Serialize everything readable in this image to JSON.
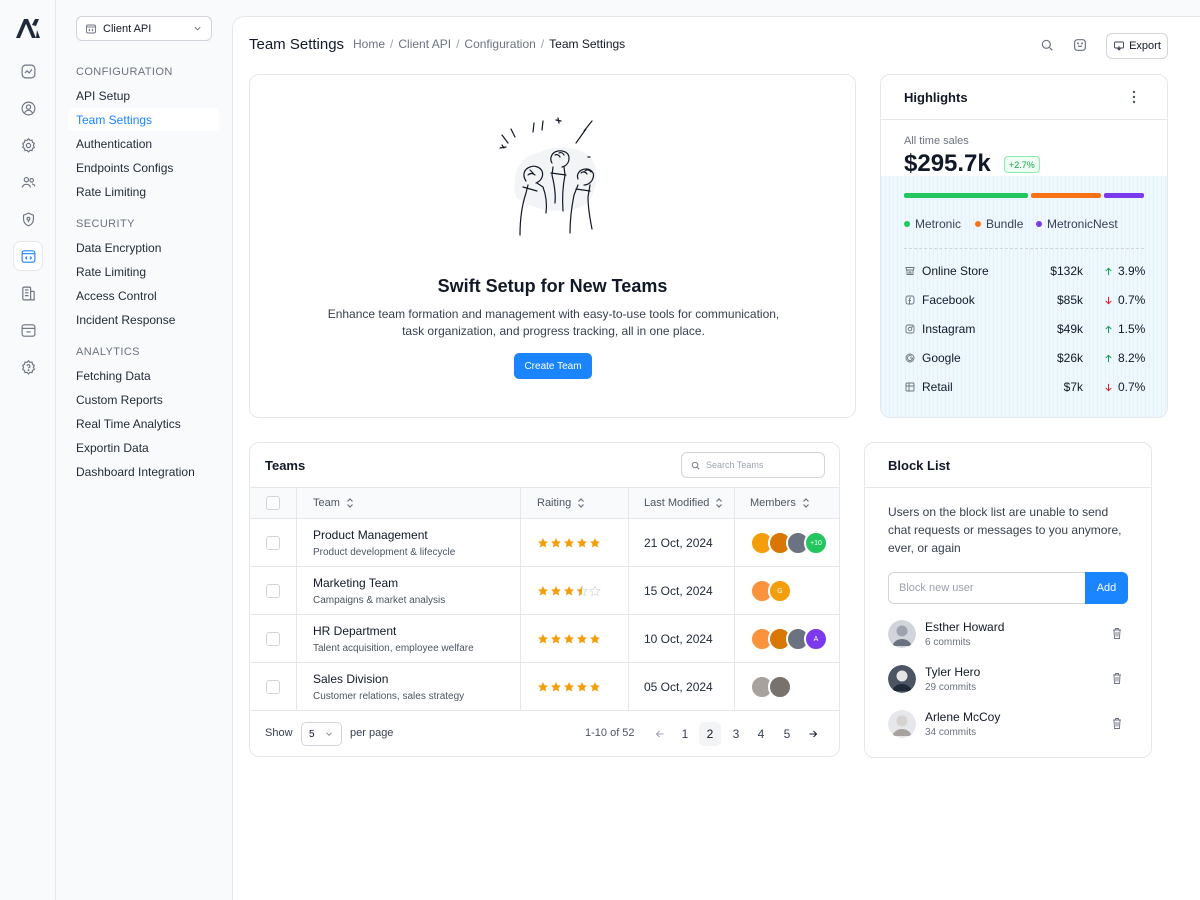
{
  "sidebar": {
    "project_selector": "Client API",
    "sections": [
      {
        "title": "CONFIGURATION",
        "items": [
          "API Setup",
          "Team Settings",
          "Authentication",
          "Endpoints Configs",
          "Rate Limiting"
        ]
      },
      {
        "title": "SECURITY",
        "items": [
          "Data Encryption",
          "Rate Limiting",
          "Access Control",
          "Incident Response"
        ]
      },
      {
        "title": "ANALYTICS",
        "items": [
          "Fetching Data",
          "Custom Reports",
          "Real Time Analytics",
          "Exportin Data",
          "Dashboard Integration"
        ]
      }
    ],
    "active_item": "Team Settings"
  },
  "header": {
    "title": "Team Settings",
    "breadcrumb": [
      "Home",
      "Client API",
      "Configuration",
      "Team Settings"
    ],
    "separator": "/",
    "export_label": "Export"
  },
  "hero": {
    "title": "Swift Setup for New Teams",
    "description": "Enhance team formation and management with easy-to-use tools for communication, task organization, and progress tracking, all in one place.",
    "button": "Create Team"
  },
  "highlights": {
    "title": "Highlights",
    "label": "All time sales",
    "value": "$295.7k",
    "change": "+2.7%",
    "segments": [
      {
        "name": "Metronic",
        "color": "#22c55e",
        "share": 0.53
      },
      {
        "name": "Bundle",
        "color": "#f97316",
        "share": 0.3
      },
      {
        "name": "MetronicNest",
        "color": "#7c3aed",
        "share": 0.17
      }
    ],
    "channels": [
      {
        "name": "Online Store",
        "icon": "store-icon",
        "value": "$132k",
        "change": "3.9%",
        "direction": "up"
      },
      {
        "name": "Facebook",
        "icon": "facebook-icon",
        "value": "$85k",
        "change": "0.7%",
        "direction": "down"
      },
      {
        "name": "Instagram",
        "icon": "instagram-icon",
        "value": "$49k",
        "change": "1.5%",
        "direction": "up"
      },
      {
        "name": "Google",
        "icon": "google-icon",
        "value": "$26k",
        "change": "8.2%",
        "direction": "up"
      },
      {
        "name": "Retail",
        "icon": "retail-icon",
        "value": "$7k",
        "change": "0.7%",
        "direction": "down"
      }
    ],
    "colors": {
      "up": "#16a34a",
      "down": "#dc2626"
    }
  },
  "teams": {
    "title": "Teams",
    "search_placeholder": "Search Teams",
    "columns": [
      "Team",
      "Raiting",
      "Last Modified",
      "Members"
    ],
    "rows": [
      {
        "name": "Product Management",
        "desc": "Product development & lifecycle",
        "rating": 5,
        "date": "21 Oct, 2024",
        "members": [
          "#f59e0b",
          "#d97706",
          "#6b7280"
        ],
        "extra": "+10",
        "extra_color": "#22c55e"
      },
      {
        "name": "Marketing Team",
        "desc": "Campaigns & market analysis",
        "rating": 3.5,
        "date": "15 Oct, 2024",
        "members": [
          "#fb923c"
        ],
        "extra": "G",
        "extra_color": "#f59e0b"
      },
      {
        "name": "HR Department",
        "desc": "Talent acquisition, employee welfare",
        "rating": 5,
        "date": "10 Oct, 2024",
        "members": [
          "#fb923c",
          "#d97706",
          "#6b7280"
        ],
        "extra": "A",
        "extra_color": "#7c3aed"
      },
      {
        "name": "Sales Division",
        "desc": "Customer relations, sales strategy",
        "rating": 5,
        "date": "05 Oct, 2024",
        "members": [
          "#a8a29e",
          "#78716c"
        ],
        "extra": "",
        "extra_color": ""
      }
    ],
    "footer": {
      "show": "Show",
      "per_page_value": "5",
      "per_page": "per page",
      "range": "1-10 of 52",
      "pages": [
        "1",
        "2",
        "3",
        "4",
        "5"
      ],
      "current_page": "2"
    }
  },
  "block_list": {
    "title": "Block List",
    "description": "Users on the block list are unable to send chat requests or messages to you anymore, ever, or again",
    "input_placeholder": "Block new user",
    "add_label": "Add",
    "users": [
      {
        "name": "Esther Howard",
        "commits": "6 commits"
      },
      {
        "name": "Tyler Hero",
        "commits": "29 commits"
      },
      {
        "name": "Arlene McCoy",
        "commits": "34 commits"
      }
    ]
  }
}
